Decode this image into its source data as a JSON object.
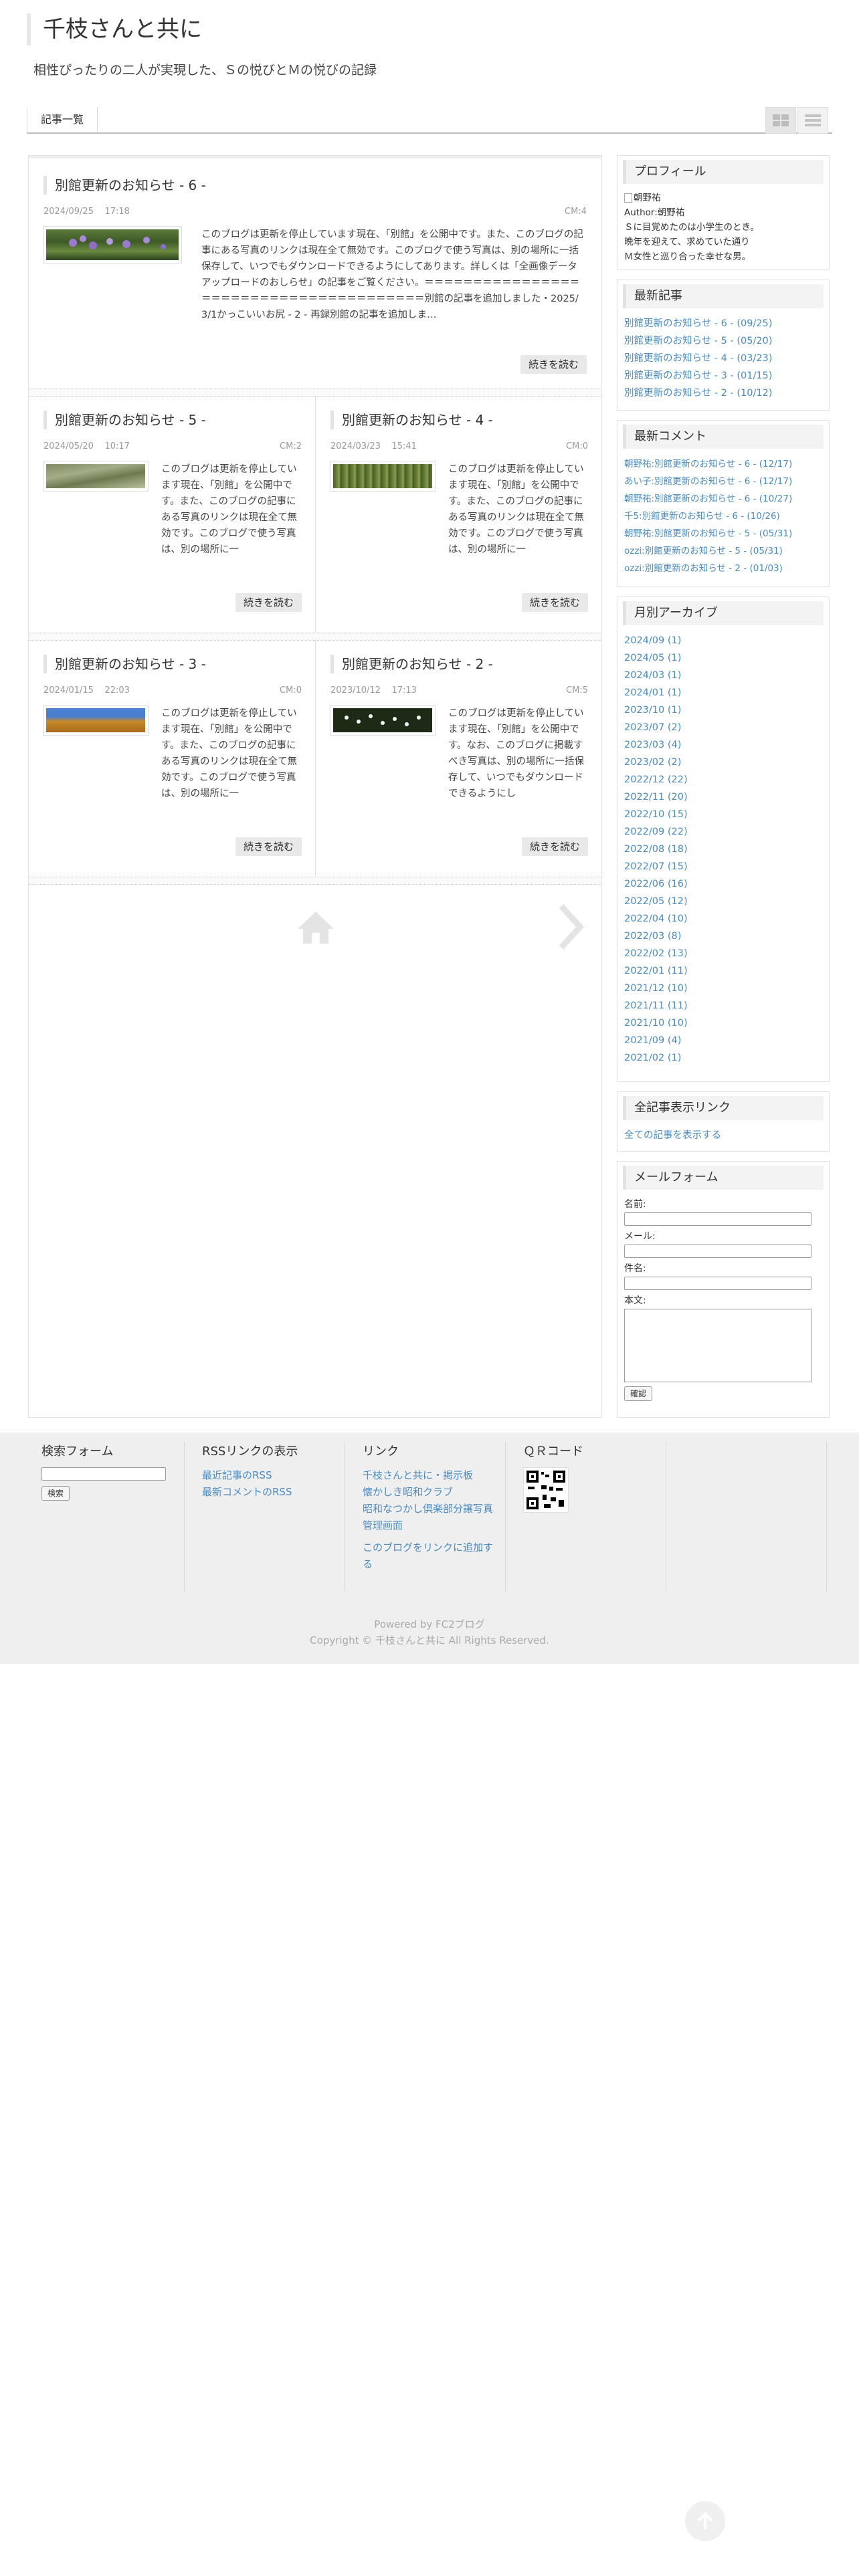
{
  "header": {
    "title": "千枝さんと共に",
    "description": "相性ぴったりの二人が実現した、Ｓの悦びとＭの悦びの記録"
  },
  "nav": {
    "entries_tab": "記事一覧"
  },
  "entries": [
    {
      "title": "別館更新のお知らせ - 6 -",
      "date": "2024/09/25",
      "time": "17:18",
      "cm": "CM:4",
      "body": "このブログは更新を停止しています現在、「別館」を公開中です。また、このブログの記事にある写真のリンクは現在全て無効です。このブログで使う写真は、別の場所に一括保存して、いつでもダウンロードできるようにしてあります。詳しくは「全画像データアップロードのおしらせ」の記事をご覧ください。＝＝＝＝＝＝＝＝＝＝＝＝＝＝＝＝＝＝＝＝＝＝＝＝＝＝＝＝＝＝＝＝＝＝＝＝＝＝＝別館の記事を追加しました・2025/3/1かっこいいお尻 - 2 - 再録別館の記事を追加しま…",
      "more": "続きを読む"
    },
    {
      "title": "別館更新のお知らせ - 5 -",
      "date": "2024/05/20",
      "time": "10:17",
      "cm": "CM:2",
      "body": "このブログは更新を停止しています現在、「別館」を公開中です。また、このブログの記事にある写真のリンクは現在全て無効です。このブログで使う写真は、別の場所に一",
      "more": "続きを読む"
    },
    {
      "title": "別館更新のお知らせ - 4 -",
      "date": "2024/03/23",
      "time": "15:41",
      "cm": "CM:0",
      "body": "このブログは更新を停止しています現在、「別館」を公開中です。また、このブログの記事にある写真のリンクは現在全て無効です。このブログで使う写真は、別の場所に一",
      "more": "続きを読む"
    },
    {
      "title": "別館更新のお知らせ - 3 -",
      "date": "2024/01/15",
      "time": "22:03",
      "cm": "CM:0",
      "body": "このブログは更新を停止しています現在、「別館」を公開中です。また、このブログの記事にある写真のリンクは現在全て無効です。このブログで使う写真は、別の場所に一",
      "more": "続きを読む"
    },
    {
      "title": "別館更新のお知らせ - 2 -",
      "date": "2023/10/12",
      "time": "17:13",
      "cm": "CM:5",
      "body": "このブログは更新を停止しています現在、「別館」を公開中です。なお、このブログに掲載すべき写真は、別の場所に一括保存して、いつでもダウンロードできるようにし",
      "more": "続きを読む"
    }
  ],
  "sidebar": {
    "profile": {
      "title": "プロフィール",
      "image_alt": "朝野祐",
      "author": "Author:朝野祐",
      "lines": [
        "Ｓに目覚めたのは小学生のとき。",
        "晩年を迎えて、求めていた通り",
        "Ｍ女性と巡り合った幸せな男。"
      ]
    },
    "recent_entries": {
      "title": "最新記事",
      "items": [
        "別館更新のお知らせ - 6 - (09/25)",
        "別館更新のお知らせ - 5 - (05/20)",
        "別館更新のお知らせ - 4 - (03/23)",
        "別館更新のお知らせ - 3 - (01/15)",
        "別館更新のお知らせ - 2 - (10/12)"
      ]
    },
    "recent_comments": {
      "title": "最新コメント",
      "items": [
        "朝野祐:別館更新のお知らせ - 6 - (12/17)",
        "あい子:別館更新のお知らせ - 6 - (12/17)",
        "朝野祐:別館更新のお知らせ - 6 - (10/27)",
        "千5:別館更新のお知らせ - 6 - (10/26)",
        "朝野祐:別館更新のお知らせ - 5 - (05/31)",
        "ozzi:別館更新のお知らせ - 5 - (05/31)",
        "ozzi:別館更新のお知らせ - 2 - (01/03)"
      ]
    },
    "archives": {
      "title": "月別アーカイブ",
      "items": [
        "2024/09 (1)",
        "2024/05 (1)",
        "2024/03 (1)",
        "2024/01 (1)",
        "2023/10 (1)",
        "2023/07 (2)",
        "2023/03 (4)",
        "2023/02 (2)",
        "2022/12 (22)",
        "2022/11 (20)",
        "2022/10 (15)",
        "2022/09 (22)",
        "2022/08 (18)",
        "2022/07 (15)",
        "2022/06 (16)",
        "2022/05 (12)",
        "2022/04 (10)",
        "2022/03 (8)",
        "2022/02 (13)",
        "2022/01 (11)",
        "2021/12 (10)",
        "2021/11 (11)",
        "2021/10 (10)",
        "2021/09 (4)",
        "2021/02 (1)"
      ]
    },
    "all_entries": {
      "title": "全記事表示リンク",
      "link": "全ての記事を表示する"
    },
    "mail_form": {
      "title": "メールフォーム",
      "name_label": "名前:",
      "mail_label": "メール:",
      "subject_label": "件名:",
      "body_label": "本文:",
      "confirm": "確認"
    }
  },
  "footer": {
    "search": {
      "title": "検索フォーム",
      "button": "検索"
    },
    "rss": {
      "title": "RSSリンクの表示",
      "links": [
        "最近記事のRSS",
        "最新コメントのRSS"
      ]
    },
    "links": {
      "title": "リンク",
      "items": [
        "千枝さんと共に・掲示板",
        "懐かしき昭和クラブ",
        "昭和なつかし倶楽部分譲写真",
        "管理画面"
      ],
      "add": "このブログをリンクに追加する"
    },
    "qr": {
      "title": "ＱＲコード"
    },
    "powered": "Powered by FC2ブログ",
    "copyright": "Copyright © 千枝さんと共に All Rights Reserved."
  },
  "colors": {
    "link": "#4a8bc2",
    "footer_bg": "#efefef",
    "button_bg": "#e9e9e9"
  },
  "icons": [
    "grid-view-icon",
    "list-view-icon",
    "home-icon",
    "next-arrow-icon",
    "page-top-icon",
    "qr-code-icon"
  ]
}
